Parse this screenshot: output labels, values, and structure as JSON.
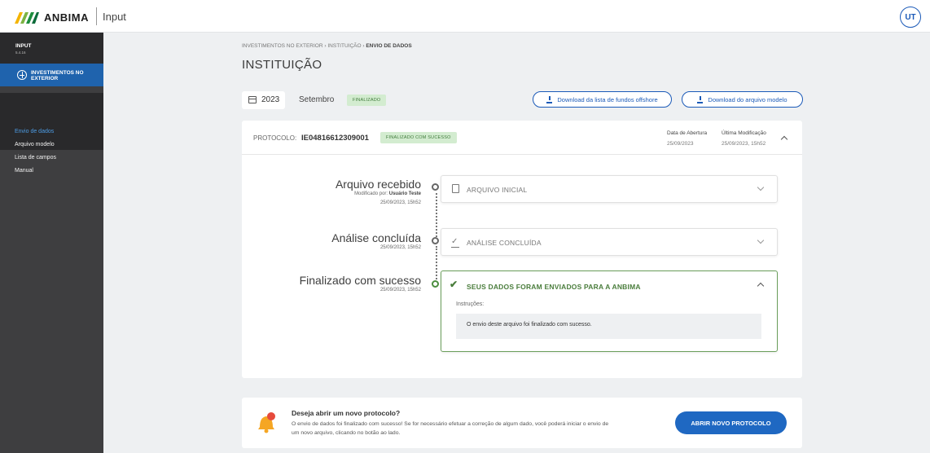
{
  "header": {
    "brand": "ANBIMA",
    "app": "Input",
    "avatar": "UT"
  },
  "sidebar": {
    "title": "INPUT",
    "version": "5.4.16",
    "section": "INVESTIMENTOS NO EXTERIOR",
    "items": [
      {
        "label": "Envio de dados",
        "active": true
      },
      {
        "label": "Arquivo modelo"
      },
      {
        "label": "Lista de campos"
      },
      {
        "label": "Manual"
      }
    ]
  },
  "breadcrumb": {
    "part1": "INVESTIMENTOS NO EXTERIOR",
    "part2": "INSTITUIÇÃO",
    "current": "ENVIO DE DADOS",
    "sep": "›"
  },
  "page_title": "INSTITUIÇÃO",
  "filters": {
    "year": "2023",
    "month": "Setembro",
    "status": "FINALIZADO"
  },
  "buttons": {
    "download_list": "Download da lista de fundos offshore",
    "download_model": "Download do arquivo modelo"
  },
  "protocol": {
    "label": "PROTOCOLO:",
    "value": "IE04816612309001",
    "status": "FINALIZADO COM SUCESSO",
    "opened_label": "Data de Abertura",
    "opened_value": "25/09/2023",
    "modified_label": "Última Modificação",
    "modified_value": "25/09/2023, 15h52"
  },
  "timeline": [
    {
      "title": "Arquivo recebido",
      "modified_by_label": "Modificado por:",
      "modified_by": "Usuário Teste",
      "date": "25/09/2023, 15h52",
      "panel": "ARQUIVO INICIAL"
    },
    {
      "title": "Análise concluída",
      "date": "25/09/2023, 15h52",
      "panel": "ANÁLISE CONCLUÍDA"
    },
    {
      "title": "Finalizado com sucesso",
      "date": "25/09/2023, 15h52",
      "panel": "SEUS DADOS FORAM ENVIADOS PARA A ANBIMA",
      "instructions_label": "Instruções:",
      "instructions": "O envio deste arquivo foi finalizado com sucesso."
    }
  ],
  "new_protocol": {
    "title": "Deseja abrir um novo protocolo?",
    "text": "O envio de dados foi finalizado com sucesso! Se for necessário efetuar a correção de algum dado, você poderá iniciar o envio de um novo arquivo, clicando no botão ao lado.",
    "button": "ABRIR NOVO PROTOCOLO"
  },
  "colors": {
    "accent": "#1b5ab8",
    "success": "#4a7d3c",
    "sidebar": "#3e3e40"
  }
}
